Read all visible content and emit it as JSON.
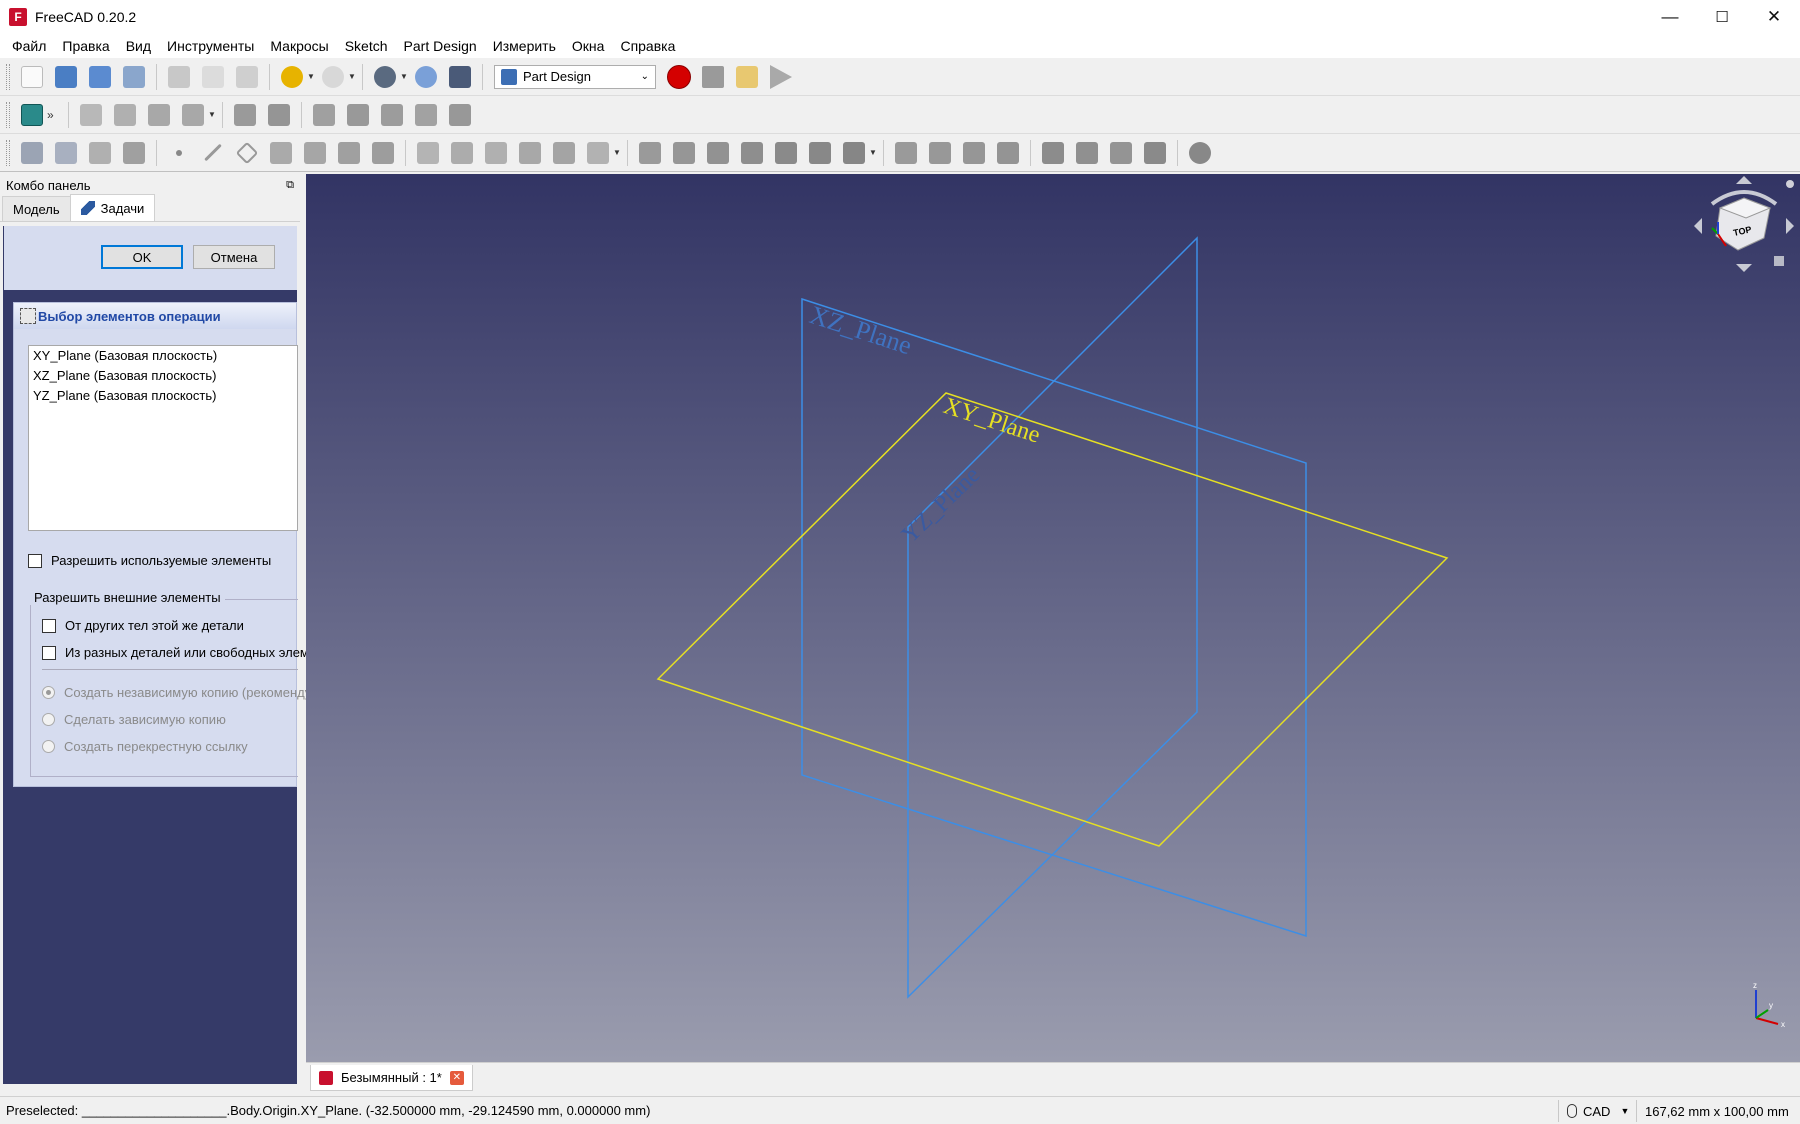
{
  "window": {
    "title": "FreeCAD 0.20.2",
    "icon": "freecad-icon",
    "min": "—",
    "max": "☐",
    "close": "✕"
  },
  "menu": [
    "Файл",
    "Правка",
    "Вид",
    "Инструменты",
    "Макросы",
    "Sketch",
    "Part Design",
    "Измерить",
    "Окна",
    "Справка"
  ],
  "toolbar": {
    "workbench": "Part Design",
    "icons_row1": [
      "new-icon",
      "open-icon",
      "save-icon",
      "save-as-icon",
      "cut-icon",
      "copy-icon",
      "paste-icon",
      "undo-icon",
      "redo-icon",
      "refresh-icon",
      "recompute-icon",
      "whats-this-icon",
      "macro-record-icon",
      "macro-stop-icon",
      "macro-edit-icon",
      "macro-run-icon"
    ],
    "icons_row2": [
      "fit-all-icon",
      "std-views-icon",
      "part-icon",
      "group-icon",
      "link-icon",
      "link-actions-icon",
      "measure-icon"
    ],
    "icons_row3": [
      "body-icon",
      "sketch-icon",
      "pad-icon",
      "pocket-icon",
      "datum-point-icon",
      "datum-line-icon",
      "datum-plane-icon",
      "cs-icon"
    ]
  },
  "combo": {
    "title": "Комбо панель",
    "tabs": [
      "Модель",
      "Задачи"
    ],
    "ok": "OK",
    "cancel": "Отмена",
    "panel_title": "Выбор элементов операции",
    "features": [
      "XY_Plane (Базовая плоскость)",
      "XZ_Plane (Базовая плоскость)",
      "YZ_Plane (Базовая плоскость)"
    ],
    "allow_used": "Разрешить используемые элементы",
    "external_group": "Разрешить внешние элементы",
    "from_other_bodies": "От других тел этой же детали",
    "from_other_parts": "Из разных деталей или свободных элеме",
    "radio_independent": "Создать независимую копию (рекоменду",
    "radio_dependent": "Сделать зависимую копию",
    "radio_cross": "Создать перекрестную ссылку"
  },
  "viewport": {
    "labels": {
      "xz": "XZ_Plane",
      "xy": "XY_Plane",
      "yz": "YZ_Plane"
    },
    "colors": {
      "xy": "#e6e022",
      "xz": "#3c8ee6",
      "yz": "#3c8ee6",
      "xz_text": "#3f72c0",
      "yz_text": "#3a5aa0"
    },
    "navcube_face": "TOP",
    "axis": {
      "x": "x",
      "y": "y",
      "z": "z"
    }
  },
  "document_tab": {
    "label": "Безымянный : 1*",
    "close": "✕"
  },
  "status": {
    "text": "Preselected: ____________________.Body.Origin.XY_Plane. (-32.500000 mm, -29.124590 mm, 0.000000 mm)",
    "nav_style": "CAD",
    "dims": "167,62 mm x 100,00 mm"
  }
}
